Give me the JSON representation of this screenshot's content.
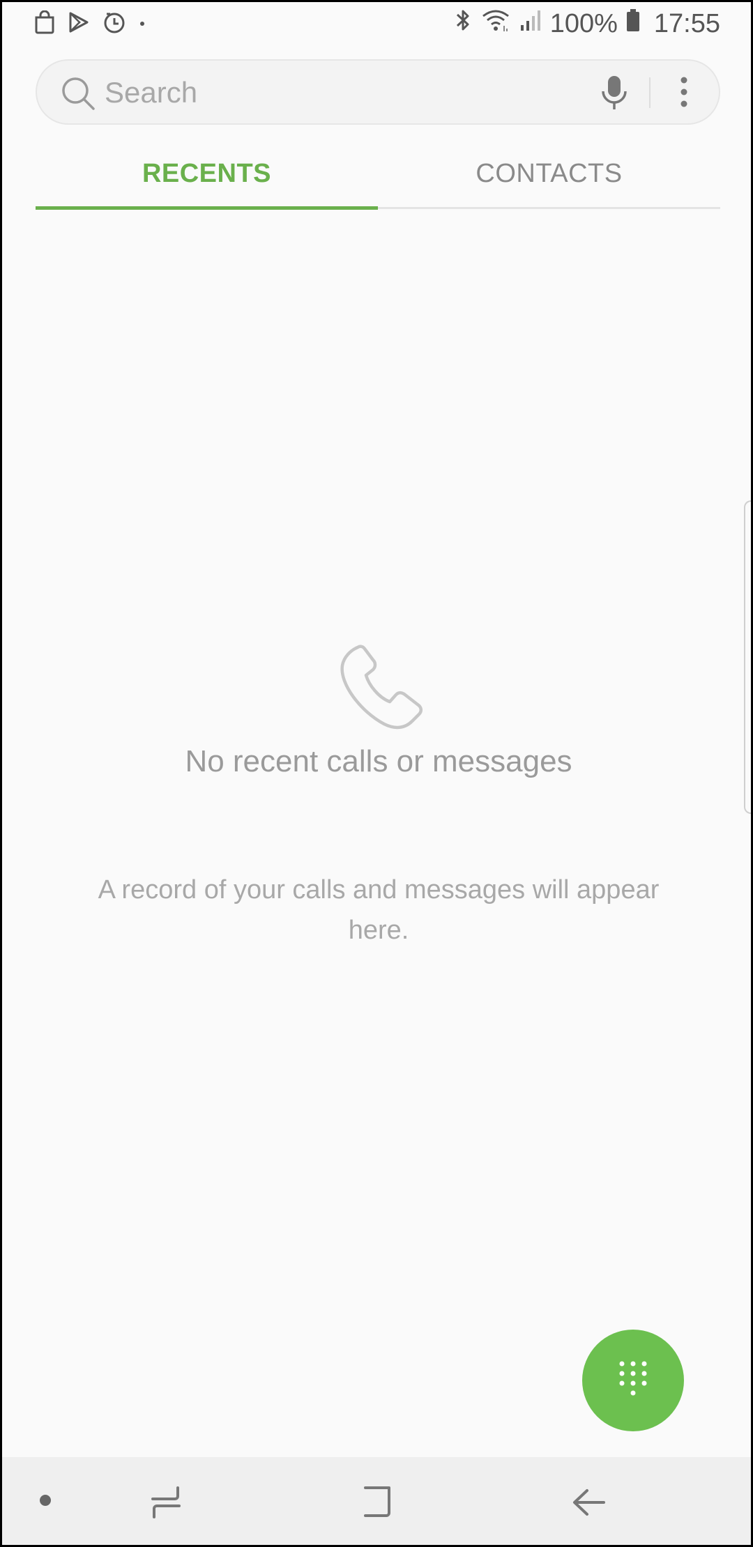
{
  "status_bar": {
    "icons_left": [
      "shopping-bag-icon",
      "play-store-icon",
      "timer-icon",
      "dot-icon"
    ],
    "icons_right": [
      "bluetooth-icon",
      "wifi-icon",
      "signal-icon",
      "battery-icon"
    ],
    "battery_text": "100%",
    "time": "17:55"
  },
  "search": {
    "placeholder": "Search",
    "icons": [
      "search-icon",
      "mic-icon",
      "more-options-icon"
    ]
  },
  "tabs": [
    {
      "label": "RECENTS",
      "active": true
    },
    {
      "label": "CONTACTS",
      "active": false
    }
  ],
  "empty_state": {
    "icon": "phone-icon",
    "title": "No recent calls or messages",
    "description": "A record of your calls and messages will appear here."
  },
  "fab": {
    "icon": "dialpad-icon"
  },
  "nav_bar": {
    "items": [
      "dot-icon",
      "recents-apps-icon",
      "home-icon",
      "back-icon"
    ]
  },
  "colors": {
    "accent": "#6ab04c",
    "fab": "#6cc04f",
    "background": "#fafafa",
    "nav_background": "#efefef"
  }
}
